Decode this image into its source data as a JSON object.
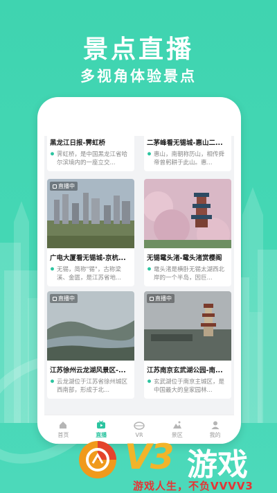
{
  "promo": {
    "title": "景点直播",
    "subtitle": "多视角体验景点"
  },
  "colors": {
    "background": "#44d7b4",
    "accent": "#2cc4a0",
    "brand_yellow": "#f2b42a",
    "brand_red": "#e63434"
  },
  "cards": [
    {
      "title": "黑龙江日报-霁虹桥",
      "desc": "霁虹桥，是中国黑龙江省哈尔滨境内的一座立交...",
      "live": false
    },
    {
      "title": "二茅峰看无锡城-惠山二...",
      "desc": "惠山，南朝称历山，相传舜帝曾躬耕于此山。惠...",
      "live": false
    },
    {
      "title": "广电大厦看无锡城-京杭...",
      "desc": "无锡，简称\"锡\"，古称梁溪、金匮，是江苏省地...",
      "live": true,
      "badge": "直播中"
    },
    {
      "title": "无锡鼋头渚-鼋头渚赏樱阁",
      "desc": "鼋头渚是横卧无锡太湖西北岸的一个半岛，因巨...",
      "live": false
    },
    {
      "title": "江苏徐州云龙湖风景区-...",
      "desc": "云龙湖位于江苏省徐州城区西南部，形成于北...",
      "live": true,
      "badge": "直播中"
    },
    {
      "title": "江苏南京玄武湖公园-南...",
      "desc": "玄武湖位于南京主城区，是中国最大的皇家园林...",
      "live": true,
      "badge": "直播中"
    }
  ],
  "tabs": [
    {
      "label": "首页",
      "icon": "home-icon"
    },
    {
      "label": "直播",
      "icon": "tv-icon",
      "active": true
    },
    {
      "label": "VR",
      "icon": "vr-icon"
    },
    {
      "label": "景区",
      "icon": "mountain-icon"
    },
    {
      "label": "我的",
      "icon": "user-icon"
    }
  ],
  "brand": {
    "logo_text": "V3",
    "name": "游戏",
    "slogan": "游戏人生，不负VVVV3"
  }
}
